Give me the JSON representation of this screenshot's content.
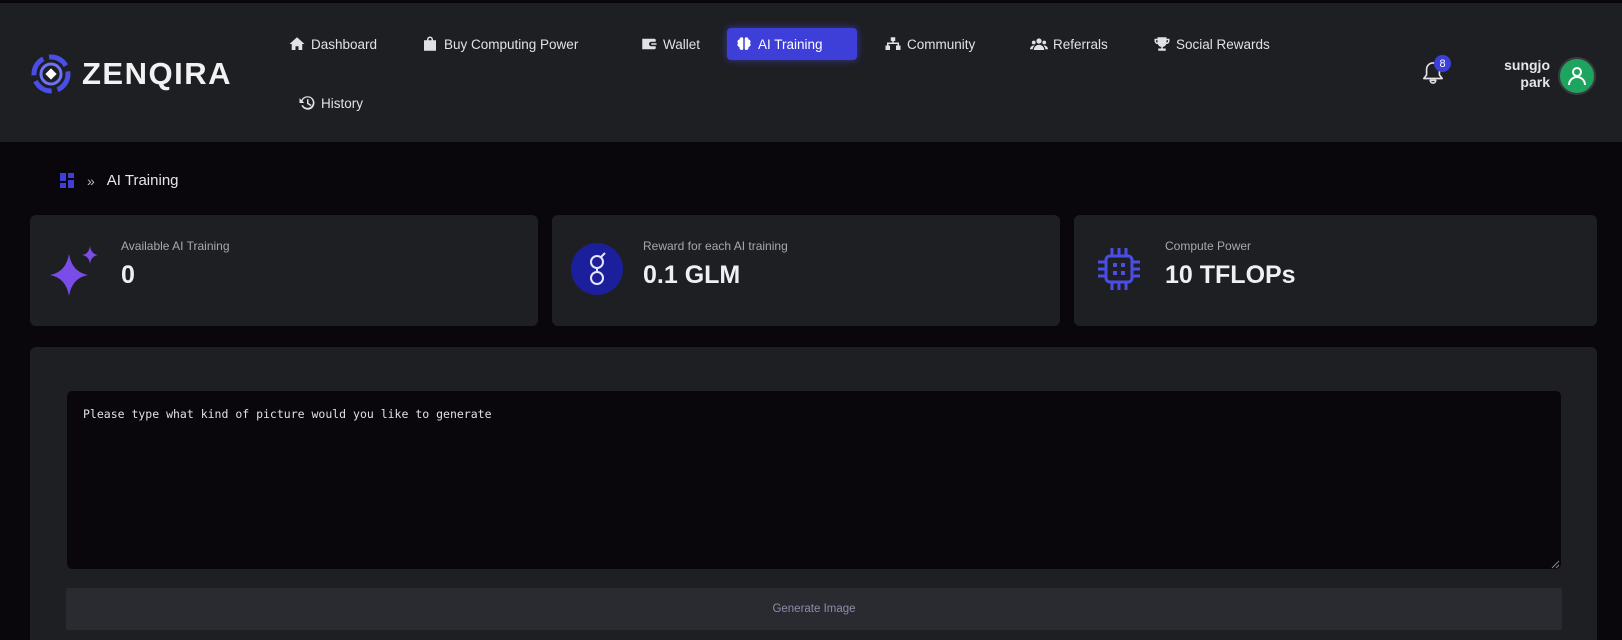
{
  "brand": {
    "name": "ZENQIRA",
    "color": "#3d3fd8"
  },
  "nav": [
    {
      "label": "Dashboard",
      "icon": "home-icon"
    },
    {
      "label": "Buy Computing Power",
      "icon": "shopping-bag-icon"
    },
    {
      "label": "Wallet",
      "icon": "wallet-icon"
    },
    {
      "label": "AI Training",
      "icon": "brain-icon",
      "active": true
    },
    {
      "label": "Community",
      "icon": "network-icon"
    },
    {
      "label": "Referrals",
      "icon": "users-icon"
    },
    {
      "label": "Social Rewards",
      "icon": "trophy-icon"
    },
    {
      "label": "History",
      "icon": "history-icon"
    }
  ],
  "notifications": {
    "count": "8",
    "icon": "bell-icon"
  },
  "user": {
    "first_name": "sungjo",
    "last_name": "park",
    "avatar_color": "#1da45f"
  },
  "breadcrumb": {
    "icon": "dashboard-grid-icon",
    "separator": "»",
    "current": "AI Training"
  },
  "stats": [
    {
      "label": "Available AI Training",
      "value": "0",
      "icon": "sparkles-icon"
    },
    {
      "label": "Reward for each AI training",
      "value": "0.1 GLM",
      "icon": "glm-coin-icon"
    },
    {
      "label": "Compute Power",
      "value": "10 TFLOPs",
      "icon": "cpu-chip-icon"
    }
  ],
  "generator": {
    "placeholder": "Please type what kind of picture would you like to generate",
    "button_label": "Generate Image"
  }
}
